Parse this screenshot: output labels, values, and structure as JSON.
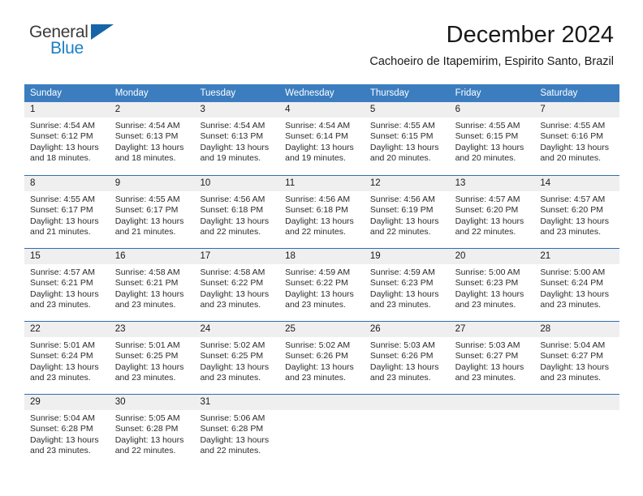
{
  "brand": {
    "name_top": "General",
    "name_bottom": "Blue",
    "accent_color": "#1b7fc4",
    "triangle_color": "#1565a8"
  },
  "header": {
    "title": "December 2024",
    "subtitle": "Cachoeiro de Itapemirim, Espirito Santo, Brazil"
  },
  "calendar": {
    "header_bg": "#3b7dbf",
    "day_band_bg": "#efefef",
    "row_border_color": "#2f6fae",
    "weekdays": [
      "Sunday",
      "Monday",
      "Tuesday",
      "Wednesday",
      "Thursday",
      "Friday",
      "Saturday"
    ],
    "weeks": [
      [
        {
          "day": "1",
          "sunrise": "Sunrise: 4:54 AM",
          "sunset": "Sunset: 6:12 PM",
          "daylight": "Daylight: 13 hours and 18 minutes."
        },
        {
          "day": "2",
          "sunrise": "Sunrise: 4:54 AM",
          "sunset": "Sunset: 6:13 PM",
          "daylight": "Daylight: 13 hours and 18 minutes."
        },
        {
          "day": "3",
          "sunrise": "Sunrise: 4:54 AM",
          "sunset": "Sunset: 6:13 PM",
          "daylight": "Daylight: 13 hours and 19 minutes."
        },
        {
          "day": "4",
          "sunrise": "Sunrise: 4:54 AM",
          "sunset": "Sunset: 6:14 PM",
          "daylight": "Daylight: 13 hours and 19 minutes."
        },
        {
          "day": "5",
          "sunrise": "Sunrise: 4:55 AM",
          "sunset": "Sunset: 6:15 PM",
          "daylight": "Daylight: 13 hours and 20 minutes."
        },
        {
          "day": "6",
          "sunrise": "Sunrise: 4:55 AM",
          "sunset": "Sunset: 6:15 PM",
          "daylight": "Daylight: 13 hours and 20 minutes."
        },
        {
          "day": "7",
          "sunrise": "Sunrise: 4:55 AM",
          "sunset": "Sunset: 6:16 PM",
          "daylight": "Daylight: 13 hours and 20 minutes."
        }
      ],
      [
        {
          "day": "8",
          "sunrise": "Sunrise: 4:55 AM",
          "sunset": "Sunset: 6:17 PM",
          "daylight": "Daylight: 13 hours and 21 minutes."
        },
        {
          "day": "9",
          "sunrise": "Sunrise: 4:55 AM",
          "sunset": "Sunset: 6:17 PM",
          "daylight": "Daylight: 13 hours and 21 minutes."
        },
        {
          "day": "10",
          "sunrise": "Sunrise: 4:56 AM",
          "sunset": "Sunset: 6:18 PM",
          "daylight": "Daylight: 13 hours and 22 minutes."
        },
        {
          "day": "11",
          "sunrise": "Sunrise: 4:56 AM",
          "sunset": "Sunset: 6:18 PM",
          "daylight": "Daylight: 13 hours and 22 minutes."
        },
        {
          "day": "12",
          "sunrise": "Sunrise: 4:56 AM",
          "sunset": "Sunset: 6:19 PM",
          "daylight": "Daylight: 13 hours and 22 minutes."
        },
        {
          "day": "13",
          "sunrise": "Sunrise: 4:57 AM",
          "sunset": "Sunset: 6:20 PM",
          "daylight": "Daylight: 13 hours and 22 minutes."
        },
        {
          "day": "14",
          "sunrise": "Sunrise: 4:57 AM",
          "sunset": "Sunset: 6:20 PM",
          "daylight": "Daylight: 13 hours and 23 minutes."
        }
      ],
      [
        {
          "day": "15",
          "sunrise": "Sunrise: 4:57 AM",
          "sunset": "Sunset: 6:21 PM",
          "daylight": "Daylight: 13 hours and 23 minutes."
        },
        {
          "day": "16",
          "sunrise": "Sunrise: 4:58 AM",
          "sunset": "Sunset: 6:21 PM",
          "daylight": "Daylight: 13 hours and 23 minutes."
        },
        {
          "day": "17",
          "sunrise": "Sunrise: 4:58 AM",
          "sunset": "Sunset: 6:22 PM",
          "daylight": "Daylight: 13 hours and 23 minutes."
        },
        {
          "day": "18",
          "sunrise": "Sunrise: 4:59 AM",
          "sunset": "Sunset: 6:22 PM",
          "daylight": "Daylight: 13 hours and 23 minutes."
        },
        {
          "day": "19",
          "sunrise": "Sunrise: 4:59 AM",
          "sunset": "Sunset: 6:23 PM",
          "daylight": "Daylight: 13 hours and 23 minutes."
        },
        {
          "day": "20",
          "sunrise": "Sunrise: 5:00 AM",
          "sunset": "Sunset: 6:23 PM",
          "daylight": "Daylight: 13 hours and 23 minutes."
        },
        {
          "day": "21",
          "sunrise": "Sunrise: 5:00 AM",
          "sunset": "Sunset: 6:24 PM",
          "daylight": "Daylight: 13 hours and 23 minutes."
        }
      ],
      [
        {
          "day": "22",
          "sunrise": "Sunrise: 5:01 AM",
          "sunset": "Sunset: 6:24 PM",
          "daylight": "Daylight: 13 hours and 23 minutes."
        },
        {
          "day": "23",
          "sunrise": "Sunrise: 5:01 AM",
          "sunset": "Sunset: 6:25 PM",
          "daylight": "Daylight: 13 hours and 23 minutes."
        },
        {
          "day": "24",
          "sunrise": "Sunrise: 5:02 AM",
          "sunset": "Sunset: 6:25 PM",
          "daylight": "Daylight: 13 hours and 23 minutes."
        },
        {
          "day": "25",
          "sunrise": "Sunrise: 5:02 AM",
          "sunset": "Sunset: 6:26 PM",
          "daylight": "Daylight: 13 hours and 23 minutes."
        },
        {
          "day": "26",
          "sunrise": "Sunrise: 5:03 AM",
          "sunset": "Sunset: 6:26 PM",
          "daylight": "Daylight: 13 hours and 23 minutes."
        },
        {
          "day": "27",
          "sunrise": "Sunrise: 5:03 AM",
          "sunset": "Sunset: 6:27 PM",
          "daylight": "Daylight: 13 hours and 23 minutes."
        },
        {
          "day": "28",
          "sunrise": "Sunrise: 5:04 AM",
          "sunset": "Sunset: 6:27 PM",
          "daylight": "Daylight: 13 hours and 23 minutes."
        }
      ],
      [
        {
          "day": "29",
          "sunrise": "Sunrise: 5:04 AM",
          "sunset": "Sunset: 6:28 PM",
          "daylight": "Daylight: 13 hours and 23 minutes."
        },
        {
          "day": "30",
          "sunrise": "Sunrise: 5:05 AM",
          "sunset": "Sunset: 6:28 PM",
          "daylight": "Daylight: 13 hours and 22 minutes."
        },
        {
          "day": "31",
          "sunrise": "Sunrise: 5:06 AM",
          "sunset": "Sunset: 6:28 PM",
          "daylight": "Daylight: 13 hours and 22 minutes."
        },
        {
          "day": "",
          "sunrise": "",
          "sunset": "",
          "daylight": ""
        },
        {
          "day": "",
          "sunrise": "",
          "sunset": "",
          "daylight": ""
        },
        {
          "day": "",
          "sunrise": "",
          "sunset": "",
          "daylight": ""
        },
        {
          "day": "",
          "sunrise": "",
          "sunset": "",
          "daylight": ""
        }
      ]
    ]
  }
}
